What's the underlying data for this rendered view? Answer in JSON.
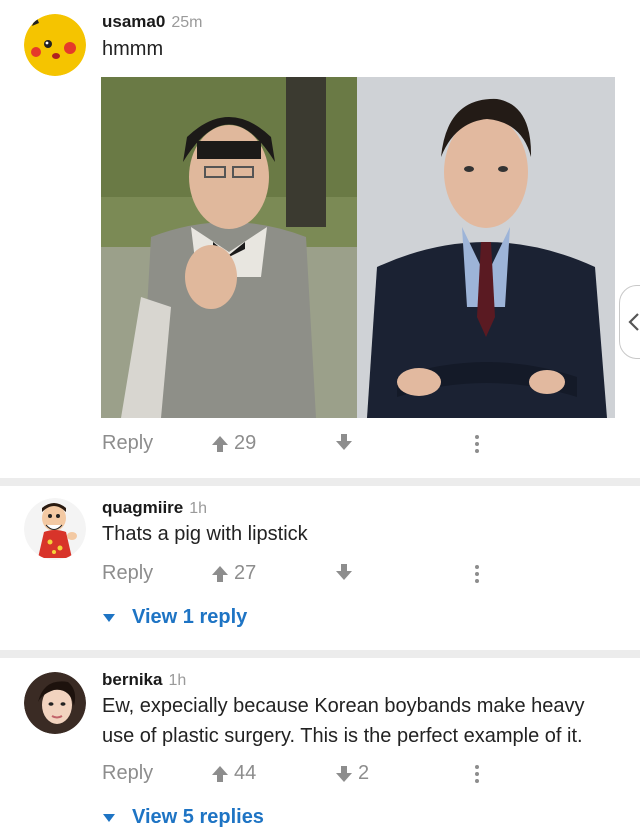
{
  "comments": [
    {
      "username": "usama0",
      "time": "25m",
      "text": "hmmm",
      "reply_label": "Reply",
      "upvotes": "29",
      "downvotes": ""
    },
    {
      "username": "quagmiire",
      "time": "1h",
      "text": "Thats a pig with lipstick",
      "reply_label": "Reply",
      "upvotes": "27",
      "downvotes": "",
      "view_replies": "View 1 reply"
    },
    {
      "username": "bernika",
      "time": "1h",
      "text": "Ew, expecially because Korean boybands make heavy use of plastic surgery. This is the perfect example of it.",
      "reply_label": "Reply",
      "upvotes": "44",
      "downvotes": "2",
      "view_replies": "View 5 replies"
    }
  ],
  "icons": {
    "upvote": "arrow-up-icon",
    "downvote": "arrow-down-icon",
    "more": "vertical-dots-icon",
    "expand": "triangle-down-icon",
    "side": "chevron-left-icon"
  },
  "colors": {
    "link": "#1e74c4",
    "muted": "#8d8d8d",
    "divider": "#ececec"
  }
}
